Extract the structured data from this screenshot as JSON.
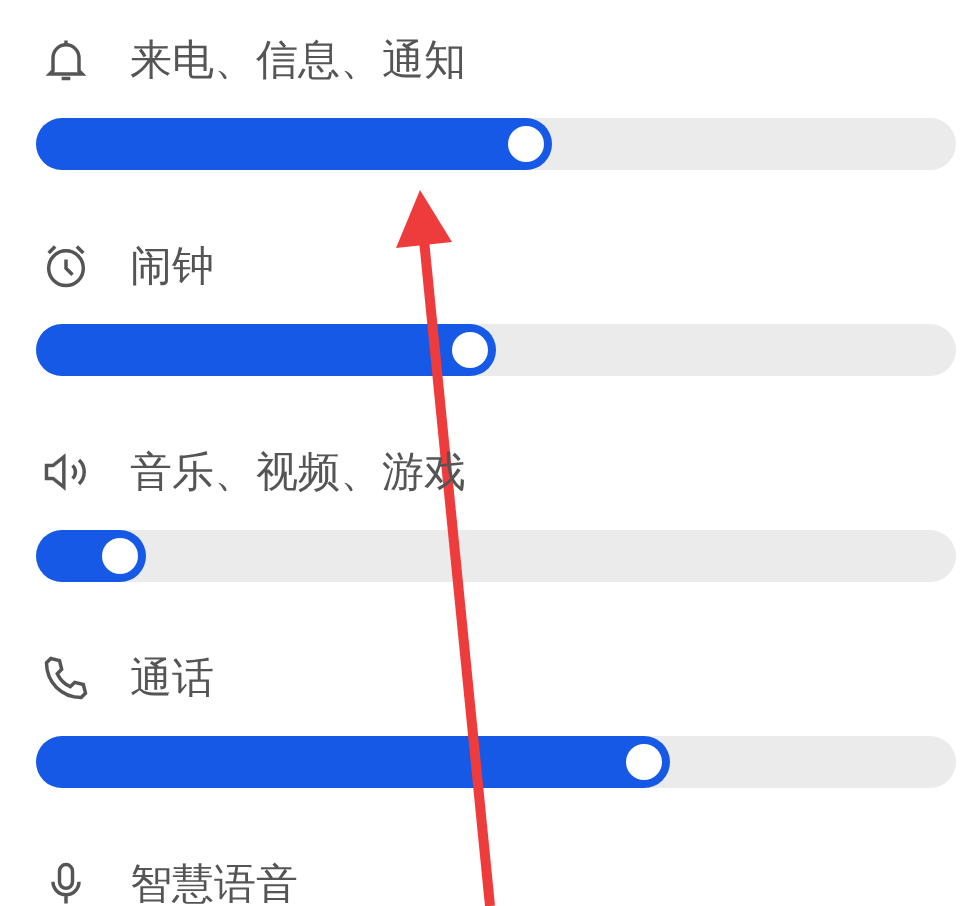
{
  "volume_settings": [
    {
      "label": "来电、信息、通知",
      "level": 0.56
    },
    {
      "label": "闹钟",
      "level": 0.5
    },
    {
      "label": "音乐、视频、游戏",
      "level": 0.12
    },
    {
      "label": "通话",
      "level": 0.69
    },
    {
      "label": "智慧语音"
    }
  ]
}
